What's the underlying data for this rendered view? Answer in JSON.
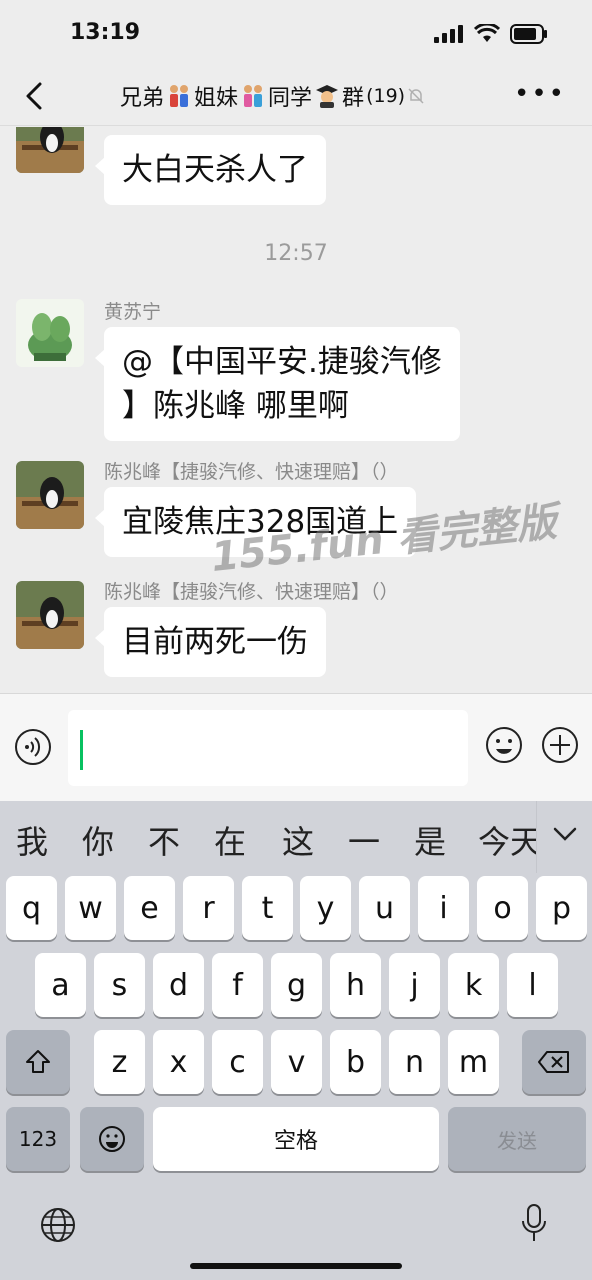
{
  "status_bar": {
    "time": "13:19"
  },
  "nav": {
    "title_parts": [
      "兄弟",
      "姐妹",
      "同学",
      "群"
    ],
    "member_count": "(19)"
  },
  "chat": {
    "messages": [
      {
        "text": "大白天杀人了"
      },
      {
        "time": "12:57"
      },
      {
        "sender": "黄苏宁",
        "text_line1": "@【中国平安.捷骏汽修",
        "text_line2": "】陈兆峰 哪里啊"
      },
      {
        "sender": "陈兆峰【捷骏汽修、快速理赔】（）",
        "text": "宜陵焦庄328国道上"
      },
      {
        "sender": "陈兆峰【捷骏汽修、快速理赔】（）",
        "text": "目前两死一伤"
      }
    ],
    "watermark": "155.fun 看完整版"
  },
  "keyboard": {
    "candidates": [
      "我",
      "你",
      "不",
      "在",
      "这",
      "一",
      "是",
      "今天"
    ],
    "row1": [
      "q",
      "w",
      "e",
      "r",
      "t",
      "y",
      "u",
      "i",
      "o",
      "p"
    ],
    "row2": [
      "a",
      "s",
      "d",
      "f",
      "g",
      "h",
      "j",
      "k",
      "l"
    ],
    "row3": [
      "z",
      "x",
      "c",
      "v",
      "b",
      "n",
      "m"
    ],
    "num_label": "123",
    "space_label": "空格",
    "send_label": "发送"
  },
  "colors": {
    "accent": "#07c160",
    "background": "#ededed",
    "keyboard": "#d1d3d9"
  }
}
